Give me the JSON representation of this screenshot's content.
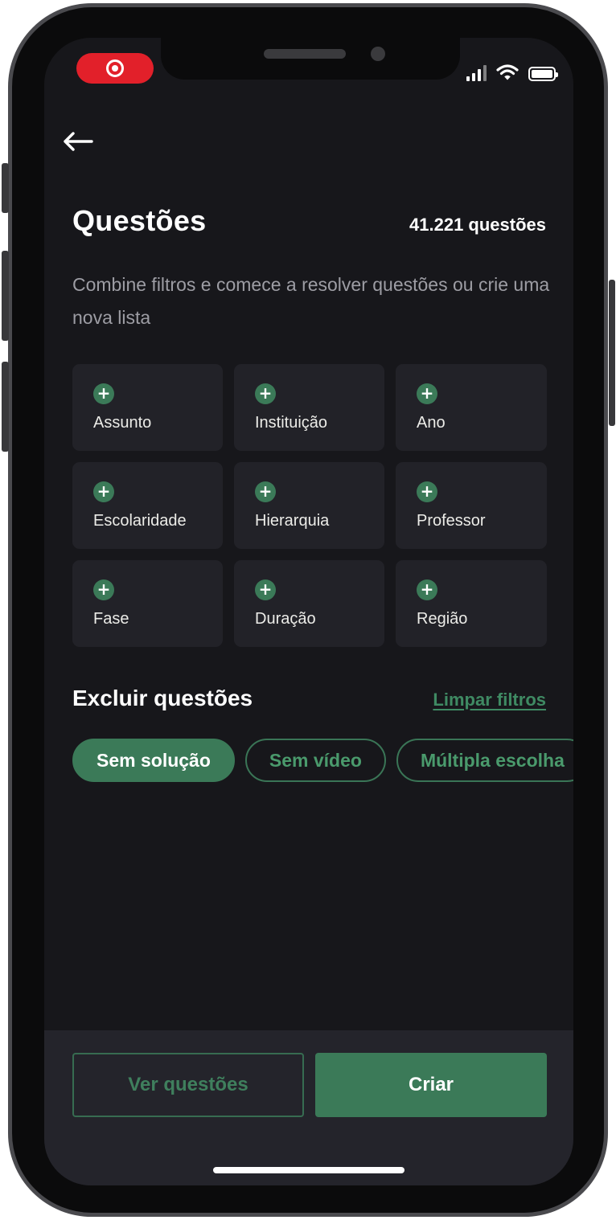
{
  "status_bar": {
    "recording_icon": "screen-record-icon",
    "signal_icon": "cellular-signal-icon",
    "wifi_icon": "wifi-icon",
    "battery_icon": "battery-icon",
    "battery_level": 1.0
  },
  "header": {
    "back_icon": "arrow-left-icon",
    "title": "Questões",
    "count": "41.221 questões"
  },
  "subtitle": "Combine filtros e comece a resolver questões ou crie uma nova lista",
  "filters": [
    {
      "label": "Assunto",
      "icon": "plus-icon"
    },
    {
      "label": "Instituição",
      "icon": "plus-icon"
    },
    {
      "label": "Ano",
      "icon": "plus-icon"
    },
    {
      "label": "Escolaridade",
      "icon": "plus-icon"
    },
    {
      "label": "Hierarquia",
      "icon": "plus-icon"
    },
    {
      "label": "Professor",
      "icon": "plus-icon"
    },
    {
      "label": "Fase",
      "icon": "plus-icon"
    },
    {
      "label": "Duração",
      "icon": "plus-icon"
    },
    {
      "label": "Região",
      "icon": "plus-icon"
    }
  ],
  "exclude": {
    "title": "Excluir questões",
    "clear_label": "Limpar filtros",
    "chips": [
      {
        "label": "Sem solução",
        "active": true
      },
      {
        "label": "Sem vídeo",
        "active": false
      },
      {
        "label": "Múltipla escolha",
        "active": false
      }
    ]
  },
  "actions": {
    "secondary_label": "Ver questões",
    "primary_label": "Criar"
  },
  "colors": {
    "accent": "#3b7a58",
    "background": "#17171b",
    "card": "#222228",
    "record": "#e2202a"
  }
}
